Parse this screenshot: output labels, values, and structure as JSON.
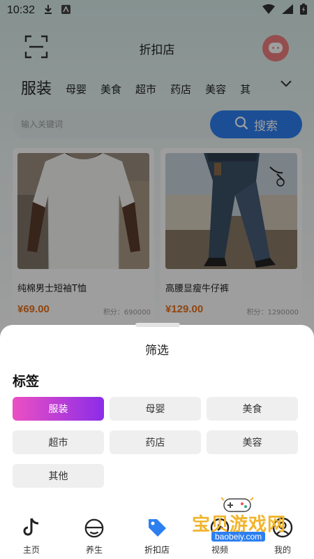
{
  "status_bar": {
    "time": "10:32"
  },
  "header": {
    "title": "折扣店"
  },
  "tabs": [
    "服装",
    "母婴",
    "美食",
    "超市",
    "药店",
    "美容",
    "其"
  ],
  "search": {
    "placeholder": "输入关键词",
    "button_label": "搜索"
  },
  "products": [
    {
      "name": "纯棉男士短袖T恤",
      "price": "¥69.00",
      "points": "积分：690000"
    },
    {
      "name": "高腰显瘦牛仔裤",
      "price": "¥129.00",
      "points": "积分：1290000"
    }
  ],
  "filter_sheet": {
    "title": "筛选",
    "section_label": "标签",
    "tags": [
      "服装",
      "母婴",
      "美食",
      "超市",
      "药店",
      "美容",
      "其他"
    ],
    "selected_tag": "服装"
  },
  "bottom_nav": [
    "主页",
    "养生",
    "折扣店",
    "视频",
    "我的"
  ],
  "bottom_nav_active": "折扣店",
  "watermark": {
    "text": "宝贝游戏网",
    "url": "baobeiy.com"
  },
  "colors": {
    "accent": "#2d7ff0",
    "price": "#e8711b",
    "tag_gradient_start": "#ec4fc2",
    "tag_gradient_end": "#8b2de8"
  }
}
